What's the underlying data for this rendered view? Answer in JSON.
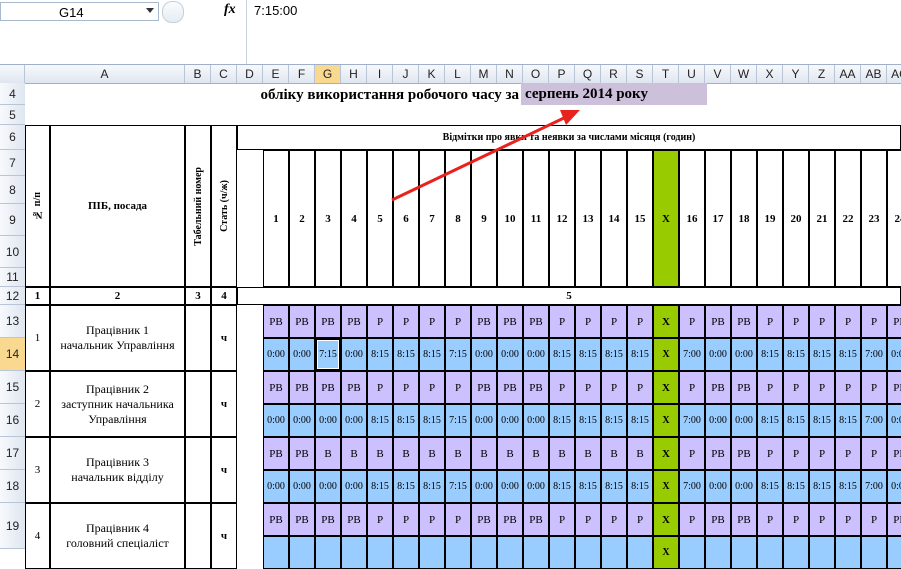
{
  "formula_bar": {
    "name_box": "G14",
    "fx": "fx",
    "value": "7:15:00"
  },
  "columns": [
    "A",
    "B",
    "C",
    "D",
    "E",
    "F",
    "G",
    "H",
    "I",
    "J",
    "K",
    "L",
    "M",
    "N",
    "O",
    "P",
    "Q",
    "R",
    "S",
    "T",
    "U",
    "V",
    "W",
    "X",
    "Y",
    "Z",
    "AA",
    "AB",
    "AC"
  ],
  "rows": [
    "4",
    "5",
    "6",
    "7",
    "8",
    "9",
    "10",
    "11",
    "12",
    "13",
    "14",
    "15",
    "16",
    "17",
    "18",
    "19"
  ],
  "title": {
    "part1": "обліку використання робочого часу за",
    "part2": "серпень 2014 року"
  },
  "header": {
    "num": "№ п/п",
    "name": "ПІБ, посада",
    "tab": "Табельний номер",
    "sex": "Стать (ч/ж)",
    "marks": "Відмітки  про явки та неявки за числами місяця (годин)",
    "days": [
      "1",
      "2",
      "3",
      "4",
      "5",
      "6",
      "7",
      "8",
      "9",
      "10",
      "11",
      "12",
      "13",
      "14",
      "15",
      "X",
      "16",
      "17",
      "18",
      "19",
      "20",
      "21",
      "22",
      "23",
      "24",
      "2"
    ],
    "idx": [
      "1",
      "2",
      "3",
      "4",
      "5"
    ]
  },
  "employees": [
    {
      "n": "1",
      "name": "Працівник 1\nначальник Управління",
      "sex": "ч",
      "codes": [
        "РВ",
        "РВ",
        "РВ",
        "РВ",
        "Р",
        "Р",
        "Р",
        "Р",
        "РВ",
        "РВ",
        "РВ",
        "Р",
        "Р",
        "Р",
        "Р",
        "X",
        "Р",
        "РВ",
        "РВ",
        "Р",
        "Р",
        "Р",
        "Р",
        "Р",
        "РВ",
        "Р"
      ],
      "hours": [
        "0:00",
        "0:00",
        "7:15",
        "0:00",
        "8:15",
        "8:15",
        "8:15",
        "7:15",
        "0:00",
        "0:00",
        "0:00",
        "8:15",
        "8:15",
        "8:15",
        "8:15",
        "X",
        "7:00",
        "0:00",
        "0:00",
        "8:15",
        "8:15",
        "8:15",
        "8:15",
        "7:00",
        "0:00",
        "0:"
      ]
    },
    {
      "n": "2",
      "name": "Працівник 2\nзаступник начальника\nУправління",
      "sex": "ч",
      "codes": [
        "РВ",
        "РВ",
        "РВ",
        "РВ",
        "Р",
        "Р",
        "Р",
        "Р",
        "РВ",
        "РВ",
        "РВ",
        "Р",
        "Р",
        "Р",
        "Р",
        "X",
        "Р",
        "РВ",
        "РВ",
        "Р",
        "Р",
        "Р",
        "Р",
        "Р",
        "РВ",
        "Р"
      ],
      "hours": [
        "0:00",
        "0:00",
        "0:00",
        "0:00",
        "8:15",
        "8:15",
        "8:15",
        "7:15",
        "0:00",
        "0:00",
        "0:00",
        "8:15",
        "8:15",
        "8:15",
        "8:15",
        "X",
        "7:00",
        "0:00",
        "0:00",
        "8:15",
        "8:15",
        "8:15",
        "8:15",
        "7:00",
        "0:00",
        "0:"
      ]
    },
    {
      "n": "3",
      "name": "Працівник 3\nначальник відділу",
      "sex": "ч",
      "codes": [
        "РВ",
        "РВ",
        "В",
        "В",
        "В",
        "В",
        "В",
        "В",
        "В",
        "В",
        "В",
        "В",
        "В",
        "В",
        "В",
        "X",
        "Р",
        "РВ",
        "РВ",
        "Р",
        "Р",
        "Р",
        "Р",
        "Р",
        "РВ",
        "Р"
      ],
      "hours": [
        "0:00",
        "0:00",
        "0:00",
        "0:00",
        "8:15",
        "8:15",
        "8:15",
        "7:15",
        "0:00",
        "0:00",
        "0:00",
        "8:15",
        "8:15",
        "8:15",
        "8:15",
        "X",
        "7:00",
        "0:00",
        "0:00",
        "8:15",
        "8:15",
        "8:15",
        "8:15",
        "7:00",
        "0:00",
        "0:"
      ]
    },
    {
      "n": "4",
      "name": "Працівник 4\nголовний спеціаліст",
      "sex": "ч",
      "codes": [
        "РВ",
        "РВ",
        "РВ",
        "РВ",
        "Р",
        "Р",
        "Р",
        "Р",
        "РВ",
        "РВ",
        "РВ",
        "Р",
        "Р",
        "Р",
        "Р",
        "X",
        "Р",
        "РВ",
        "РВ",
        "Р",
        "Р",
        "Р",
        "Р",
        "Р",
        "РВ",
        "Р"
      ],
      "hours": []
    }
  ]
}
